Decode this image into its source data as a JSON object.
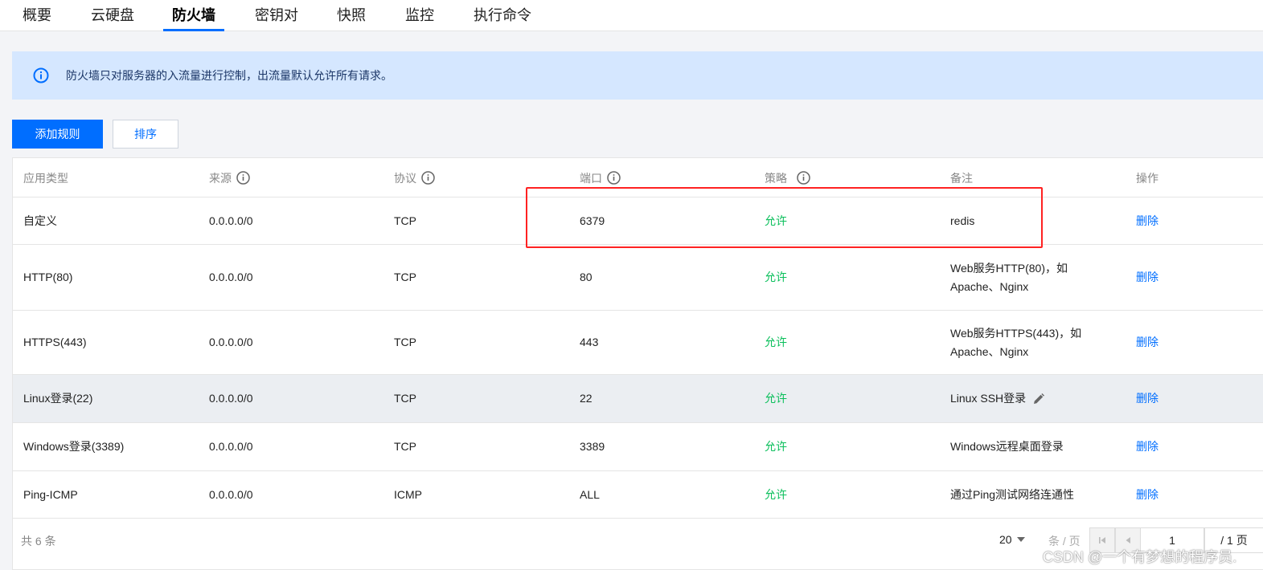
{
  "tabs": [
    {
      "label": "概要"
    },
    {
      "label": "云硬盘"
    },
    {
      "label": "防火墙",
      "active": true
    },
    {
      "label": "密钥对"
    },
    {
      "label": "快照"
    },
    {
      "label": "监控"
    },
    {
      "label": "执行命令"
    }
  ],
  "banner": {
    "text": "防火墙只对服务器的入流量进行控制，出流量默认允许所有请求。",
    "icon": "info-icon"
  },
  "toolbar": {
    "add_label": "添加规则",
    "sort_label": "排序"
  },
  "table": {
    "columns": [
      "应用类型",
      "来源",
      "协议",
      "端口",
      "策略",
      "备注",
      "操作"
    ],
    "rows": [
      {
        "app": "自定义",
        "source": "0.0.0.0/0",
        "protocol": "TCP",
        "port": "6379",
        "policy": "允许",
        "note": "redis",
        "action": "删除"
      },
      {
        "app": "HTTP(80)",
        "source": "0.0.0.0/0",
        "protocol": "TCP",
        "port": "80",
        "policy": "允许",
        "note": "Web服务HTTP(80)，如Apache、Nginx",
        "action": "删除"
      },
      {
        "app": "HTTPS(443)",
        "source": "0.0.0.0/0",
        "protocol": "TCP",
        "port": "443",
        "policy": "允许",
        "note": "Web服务HTTPS(443)，如Apache、Nginx",
        "action": "删除"
      },
      {
        "app": "Linux登录(22)",
        "source": "0.0.0.0/0",
        "protocol": "TCP",
        "port": "22",
        "policy": "允许",
        "note": "Linux SSH登录",
        "action": "删除"
      },
      {
        "app": "Windows登录(3389)",
        "source": "0.0.0.0/0",
        "protocol": "TCP",
        "port": "3389",
        "policy": "允许",
        "note": "Windows远程桌面登录",
        "action": "删除"
      },
      {
        "app": "Ping-ICMP",
        "source": "0.0.0.0/0",
        "protocol": "ICMP",
        "port": "ALL",
        "policy": "允许",
        "note": "通过Ping测试网络连通性",
        "action": "删除"
      }
    ]
  },
  "footer": {
    "total": "共 6 条",
    "page_size": "20",
    "per_page": "条 / 页",
    "current_page": "1",
    "total_pages": "/ 1 页"
  },
  "watermark": "CSDN @一个有梦想的程序员.",
  "colors": {
    "primary": "#006eff",
    "allow": "#0abf5b",
    "banner": "#d5e7ff",
    "annotation": "#ff2222"
  }
}
